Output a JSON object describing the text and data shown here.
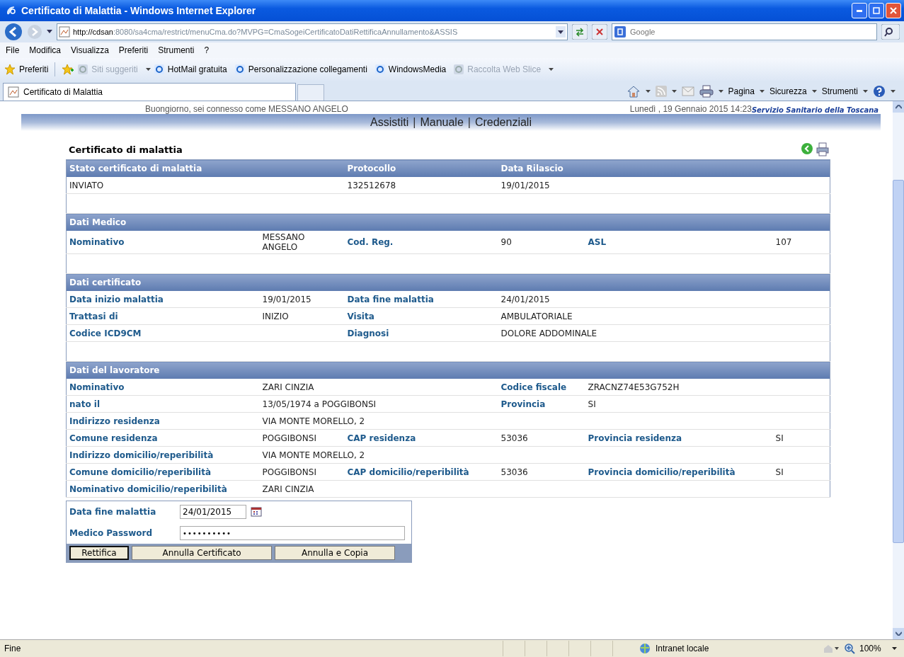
{
  "window": {
    "title": "Certificato di Malattia - Windows Internet Explorer"
  },
  "address_bar": {
    "url_host": "http://cdsan",
    "url_rest": ":8080/sa4cma/restrict/menuCma.do?MVPG=CmaSogeiCertificatoDatiRettificaAnnullamento&ASSIS",
    "search_placeholder": "Google"
  },
  "menu": [
    "File",
    "Modifica",
    "Visualizza",
    "Preferiti",
    "Strumenti",
    "?"
  ],
  "favorites_bar": {
    "label": "Preferiti",
    "items": [
      {
        "label": "Siti suggeriti",
        "disabled": true,
        "dropdown": true
      },
      {
        "label": "HotMail gratuita",
        "disabled": false,
        "dropdown": false
      },
      {
        "label": "Personalizzazione collegamenti",
        "disabled": false,
        "dropdown": false
      },
      {
        "label": "WindowsMedia",
        "disabled": false,
        "dropdown": false
      },
      {
        "label": "Raccolta Web Slice",
        "disabled": true,
        "dropdown": true
      }
    ]
  },
  "tab": {
    "label": "Certificato di Malattia"
  },
  "command_bar": [
    "Pagina",
    "Sicurezza",
    "Strumenti"
  ],
  "page": {
    "greeting": "Buongiorno, sei connesso come MESSANO ANGELO",
    "date": "Lunedì , 19 Gennaio 2015 14:23",
    "brand": "Servizio Sanitario della Toscana",
    "nav": [
      "Assistiti",
      "Manuale",
      "Credenziali"
    ],
    "nav_separator": "|",
    "title": "Certificato di malattia",
    "sections": [
      {
        "kind": "status",
        "header": [
          "Stato certificato di malattia",
          "Protocollo",
          "Data Rilascio"
        ],
        "rows": [
          {
            "kind": "status",
            "cells": [
              "INVIATO",
              "132512678",
              "19/01/2015"
            ]
          }
        ]
      },
      {
        "kind": "titled",
        "header": [
          "Dati Medico"
        ],
        "rows": [
          {
            "kind": "three_pairs",
            "cells": [
              "Nominativo",
              "MESSANO ANGELO",
              "Cod. Reg.",
              "90",
              "ASL",
              "107"
            ]
          }
        ]
      },
      {
        "kind": "titled",
        "header": [
          "Dati certificato"
        ],
        "rows": [
          {
            "kind": "two_pairs",
            "cells": [
              "Data inizio malattia",
              "19/01/2015",
              "Data fine malattia",
              "24/01/2015"
            ]
          },
          {
            "kind": "two_pairs",
            "cells": [
              "Trattasi di",
              "INIZIO",
              "Visita",
              "AMBULATORIALE"
            ]
          },
          {
            "kind": "two_pairs",
            "cells": [
              "Codice ICD9CM",
              "",
              "Diagnosi",
              "DOLORE ADDOMINALE"
            ]
          }
        ]
      },
      {
        "kind": "titled",
        "header": [
          "Dati del lavoratore"
        ],
        "rows": [
          {
            "kind": "pairs_gapped",
            "cells": [
              "Nominativo",
              "ZARI CINZIA",
              "",
              "Codice fiscale",
              "ZRACNZ74E53G752H",
              ""
            ]
          },
          {
            "kind": "pairs_gapped",
            "cells": [
              "nato il",
              "13/05/1974 a POGGIBONSI",
              "",
              "Provincia",
              "SI",
              ""
            ]
          },
          {
            "kind": "single",
            "cells": [
              "Indirizzo residenza",
              "VIA MONTE MORELLO, 2",
              "",
              "",
              "",
              ""
            ]
          },
          {
            "kind": "three_pairs",
            "cells": [
              "Comune residenza",
              "POGGIBONSI",
              "CAP residenza",
              "53036",
              "Provincia residenza",
              "SI"
            ]
          },
          {
            "kind": "single",
            "cells": [
              "Indirizzo domicilio/reperibilità",
              "VIA MONTE MORELLO, 2",
              "",
              "",
              "",
              ""
            ]
          },
          {
            "kind": "three_pairs",
            "cells": [
              "Comune domicilio/reperibilità",
              "POGGIBONSI",
              "CAP domicilio/reperibilità",
              "53036",
              "Provincia domicilio/reperibilità",
              "SI"
            ]
          },
          {
            "kind": "single",
            "cells": [
              "Nominativo domicilio/reperibilità",
              "ZARI CINZIA",
              "",
              "",
              "",
              ""
            ]
          }
        ]
      }
    ],
    "form": {
      "fields": [
        {
          "label": "Data fine malattia",
          "value": "24/01/2015",
          "kind": "date"
        },
        {
          "label": "Medico Password",
          "value": "••••••••••",
          "kind": "password"
        }
      ],
      "buttons": [
        {
          "label": "Rettifica",
          "default": true
        },
        {
          "label": "Annulla Certificato",
          "default": false
        },
        {
          "label": "Annulla e Copia",
          "default": false
        }
      ]
    }
  },
  "status_bar": {
    "text": "Fine",
    "zone": "Intranet locale",
    "zoom": "100%"
  }
}
